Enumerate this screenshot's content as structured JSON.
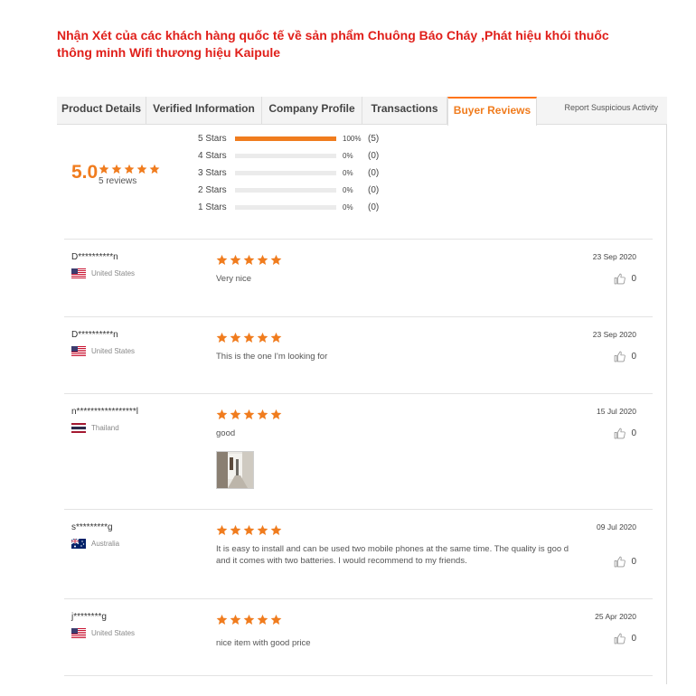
{
  "headline": "Nhận Xét của các khách hàng quốc tế về sản phẩm  Chuông Báo Cháy ,Phát hiệu khói thuốc thông minh Wifi  thương hiệu Kaipule",
  "tabs": [
    {
      "label": "Product Details",
      "active": false
    },
    {
      "label": "Verified Information",
      "active": false
    },
    {
      "label": "Company Profile",
      "active": false
    },
    {
      "label": "Transactions",
      "active": false
    },
    {
      "label": "Buyer Reviews",
      "active": true
    }
  ],
  "report_link": "Report Suspicious Activity",
  "summary": {
    "score": "5.0",
    "reviews_count": "5 reviews",
    "score_stars": 5,
    "distribution": [
      {
        "label": "5 Stars",
        "percent": "100%",
        "count": "(5)",
        "fraction": 1.0
      },
      {
        "label": "4 Stars",
        "percent": "0%",
        "count": "(0)",
        "fraction": 0
      },
      {
        "label": "3 Stars",
        "percent": "0%",
        "count": "(0)",
        "fraction": 0
      },
      {
        "label": "2 Stars",
        "percent": "0%",
        "count": "(0)",
        "fraction": 0
      },
      {
        "label": "1 Stars",
        "percent": "0%",
        "count": "(0)",
        "fraction": 0
      }
    ]
  },
  "colors": {
    "accent": "#f07c1e",
    "headline": "#e0201b",
    "star": "#f07c1e"
  },
  "icons": {
    "star": "star-icon",
    "like": "thumbs-up-icon"
  },
  "reviews": [
    {
      "user": "D**********n",
      "country": "United States",
      "flag": "us",
      "date": "23 Sep 2020",
      "likes": "0",
      "stars": 5,
      "text": "Very nice"
    },
    {
      "user": "D**********n",
      "country": "United States",
      "flag": "us",
      "date": "23 Sep 2020",
      "likes": "0",
      "stars": 5,
      "text": "This is the one I'm looking for"
    },
    {
      "user": "n*****************l",
      "country": "Thailand",
      "flag": "th",
      "date": "15 Jul 2020",
      "likes": "0",
      "stars": 5,
      "text": "good"
    },
    {
      "user": "s*********g",
      "country": "Australia",
      "flag": "au",
      "date": "09 Jul 2020",
      "likes": "0",
      "stars": 5,
      "text": "It is easy to install and can be used two mobile phones at the same time. The quality is goo d and it comes with two batteries. I would recommend to my friends."
    },
    {
      "user": "j********g",
      "country": "United States",
      "flag": "us",
      "date": "25 Apr 2020",
      "likes": "0",
      "stars": 5,
      "text": "nice item with good price"
    }
  ]
}
